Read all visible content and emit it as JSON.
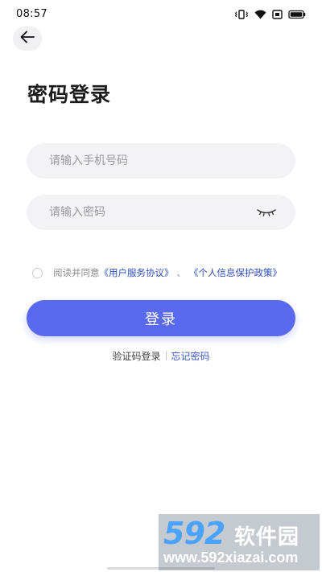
{
  "status_bar": {
    "time": "08:57",
    "icons": [
      "vibrate-icon",
      "wifi-icon",
      "sim-icon",
      "battery-icon"
    ]
  },
  "header": {
    "back_icon": "arrow-left-icon",
    "title": "密码登录"
  },
  "form": {
    "phone_placeholder": "请输入手机号码",
    "phone_value": "",
    "password_placeholder": "请输入密码",
    "password_value": "",
    "eye_icon": "eye-closed-icon"
  },
  "agreement": {
    "checked": false,
    "prefix": "阅读并同意",
    "user_agreement": "《用户服务协议》",
    "separator": "、",
    "privacy_policy": "《个人信息保护政策》"
  },
  "login_button": "登录",
  "links": {
    "sms_login": "验证码登录",
    "forgot_password": "忘记密码"
  },
  "watermark": {
    "logo": "592",
    "name": "软件园",
    "url": "www.592xiazai.com"
  },
  "colors": {
    "primary": "#5a6af0",
    "link": "#2f4fb8",
    "field_bg": "#f3f3f5",
    "placeholder": "#9a9a9e"
  }
}
